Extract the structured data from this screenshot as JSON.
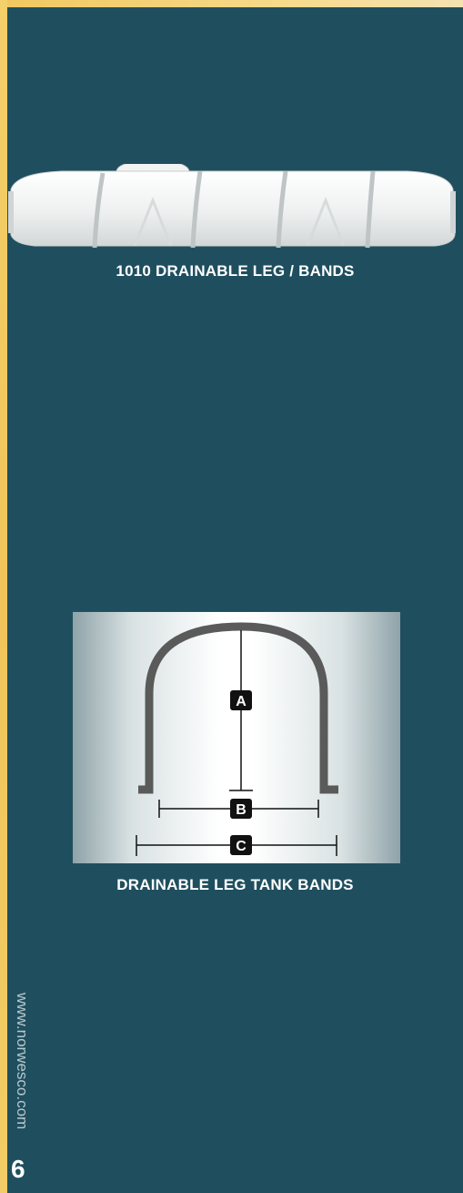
{
  "figures": [
    {
      "caption": "1010 DRAINABLE LEG / BANDS"
    },
    {
      "caption": "DRAINABLE LEG TANK BANDS",
      "dimension_labels": [
        "A",
        "B",
        "C"
      ]
    }
  ],
  "footer": {
    "website": "www.norwesco.com",
    "page_number": "6"
  },
  "colors": {
    "background": "#1f4f5f",
    "accent_border": "#f0c45a",
    "band_gray": "#5a5a5a",
    "label_black": "#111111"
  }
}
